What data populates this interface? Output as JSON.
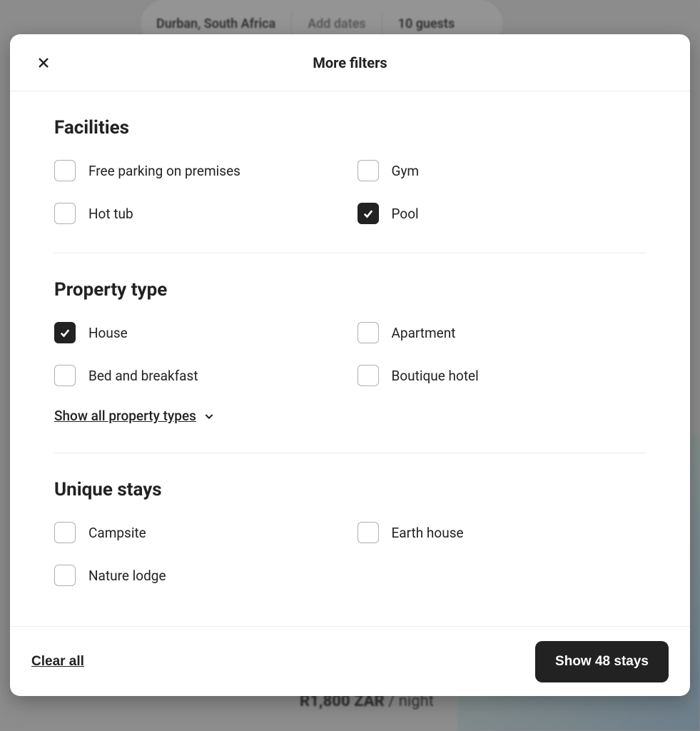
{
  "background": {
    "search_location": "Durban, South Africa",
    "search_dates": "Add dates",
    "search_guests": "10 guests",
    "price_amount": "R1,800 ZAR",
    "price_suffix": " / night"
  },
  "modal": {
    "title": "More filters",
    "sections": {
      "facilities": {
        "title": "Facilities",
        "options": [
          {
            "label": "Free parking on premises",
            "checked": false
          },
          {
            "label": "Gym",
            "checked": false
          },
          {
            "label": "Hot tub",
            "checked": false
          },
          {
            "label": "Pool",
            "checked": true
          }
        ]
      },
      "property_type": {
        "title": "Property type",
        "options": [
          {
            "label": "House",
            "checked": true
          },
          {
            "label": "Apartment",
            "checked": false
          },
          {
            "label": "Bed and breakfast",
            "checked": false
          },
          {
            "label": "Boutique hotel",
            "checked": false
          }
        ],
        "show_all_label": "Show all property types"
      },
      "unique_stays": {
        "title": "Unique stays",
        "options": [
          {
            "label": "Campsite",
            "checked": false
          },
          {
            "label": "Earth house",
            "checked": false
          },
          {
            "label": "Nature lodge",
            "checked": false
          }
        ]
      }
    },
    "footer": {
      "clear_all_label": "Clear all",
      "submit_label": "Show 48 stays"
    }
  }
}
